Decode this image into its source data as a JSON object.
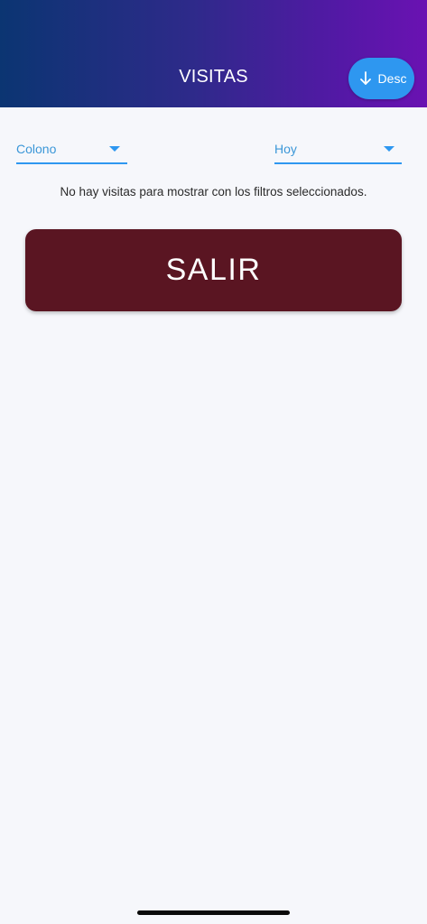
{
  "header": {
    "title": "VISITAS",
    "sort_button": {
      "label": "Desc",
      "icon": "arrow-down-icon"
    }
  },
  "filters": {
    "left": {
      "value": "Colono",
      "icon": "caret-down-icon"
    },
    "right": {
      "value": "Hoy",
      "icon": "caret-down-icon"
    }
  },
  "content": {
    "empty_message": "No hay visitas para mostrar con los filtros seleccionados."
  },
  "actions": {
    "exit_label": "SALIR"
  },
  "colors": {
    "header_gradient_start": "#0b3572",
    "header_gradient_end": "#6a12b2",
    "accent": "#2e97f0",
    "exit_button": "#5a1522",
    "background": "#f6f7fb"
  }
}
